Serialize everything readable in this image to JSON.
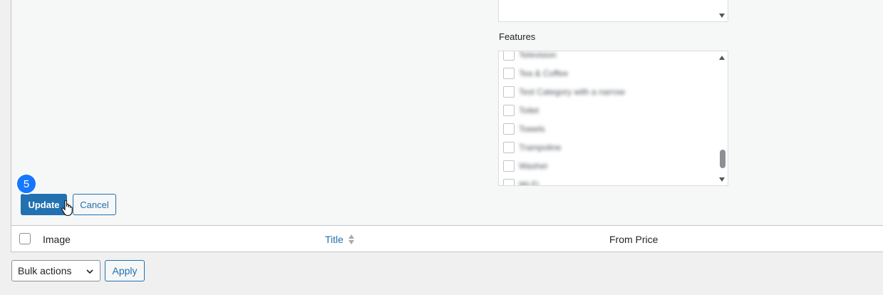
{
  "features": {
    "label": "Features",
    "items": [
      {
        "label": "Television"
      },
      {
        "label": "Tea & Coffee"
      },
      {
        "label": "Test Category with a narrow"
      },
      {
        "label": "Toilet"
      },
      {
        "label": "Towels"
      },
      {
        "label": "Trampoline"
      },
      {
        "label": "Washer"
      },
      {
        "label": "Wi-Fi"
      }
    ]
  },
  "step_badge": "5",
  "buttons": {
    "update": "Update",
    "cancel": "Cancel",
    "apply": "Apply"
  },
  "table": {
    "columns": [
      "Image",
      "Title",
      "From Price"
    ]
  },
  "bulk_actions": {
    "selected": "Bulk actions"
  },
  "colors": {
    "primary": "#2271b1",
    "badge": "#1677ff",
    "background": "#f0f0f1"
  }
}
